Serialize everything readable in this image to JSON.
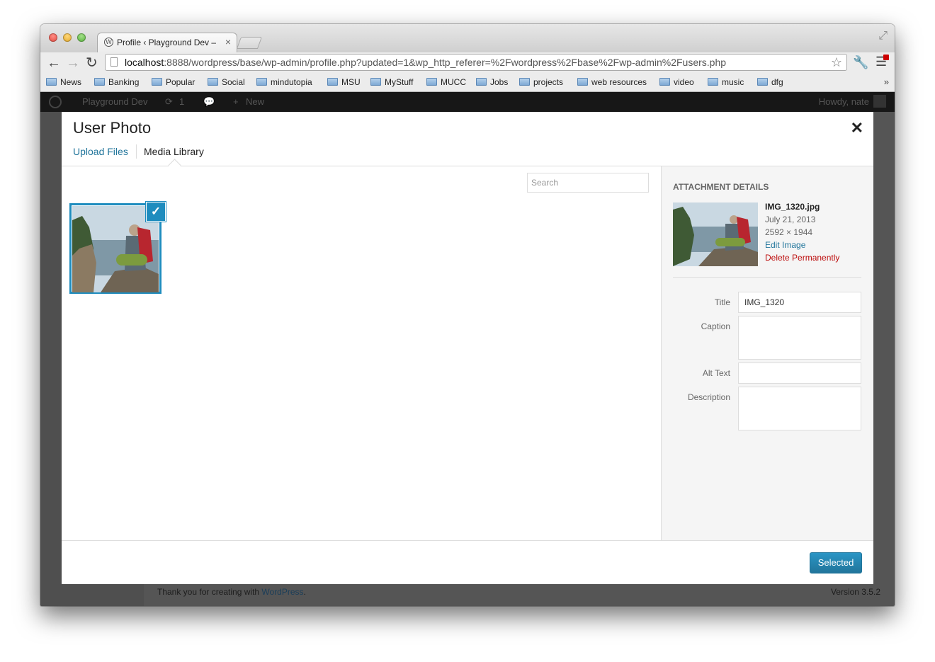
{
  "browser": {
    "tab_title": "Profile ‹ Playground Dev —",
    "url_host": "localhost",
    "url_rest": ":8888/wordpress/base/wp-admin/profile.php?updated=1&wp_http_referer=%2Fwordpress%2Fbase%2Fwp-admin%2Fusers.php",
    "bookmarks": [
      "News",
      "Banking",
      "Popular",
      "Social",
      "mindutopia",
      "MSU",
      "MyStuff",
      "MUCC",
      "Jobs",
      "projects",
      "web resources",
      "video",
      "music",
      "dfg"
    ]
  },
  "adminbar": {
    "site_name": "Playground Dev",
    "updates_count": "1",
    "new_label": "New",
    "howdy": "Howdy, nate"
  },
  "footer": {
    "thanks_prefix": "Thank you for creating with ",
    "thanks_link": "WordPress",
    "thanks_suffix": ".",
    "version": "Version 3.5.2"
  },
  "modal": {
    "title": "User Photo",
    "tabs": {
      "upload": "Upload Files",
      "library": "Media Library"
    },
    "search_placeholder": "Search",
    "details": {
      "heading": "ATTACHMENT DETAILS",
      "filename": "IMG_1320.jpg",
      "date": "July 21, 2013",
      "dimensions": "2592 × 1944",
      "edit_link": "Edit Image",
      "delete_link": "Delete Permanently"
    },
    "fields": {
      "title_label": "Title",
      "title_value": "IMG_1320",
      "caption_label": "Caption",
      "alt_label": "Alt Text",
      "description_label": "Description"
    },
    "select_button": "Selected"
  }
}
